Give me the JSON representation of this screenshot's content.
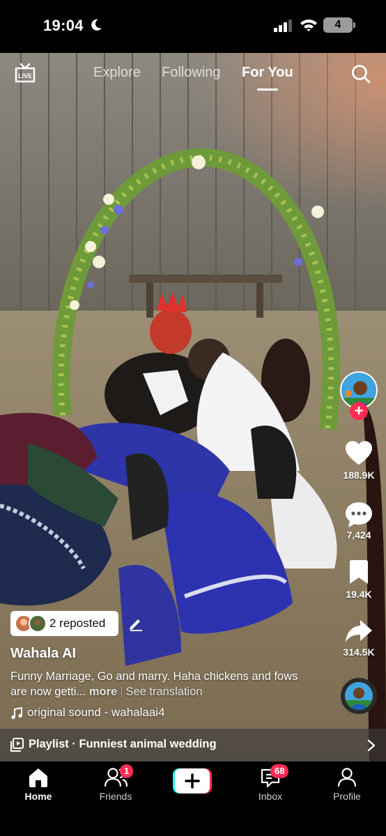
{
  "status_bar": {
    "time": "19:04",
    "battery": "4"
  },
  "top_nav": {
    "live_label": "LIVE",
    "tabs": [
      {
        "label": "Explore",
        "active": false
      },
      {
        "label": "Following",
        "active": false
      },
      {
        "label": "For You",
        "active": true
      }
    ]
  },
  "right_rail": {
    "likes": "188.9K",
    "comments": "7,424",
    "saves": "19.4K",
    "shares": "314.5K"
  },
  "post": {
    "repost_label": "2 reposted",
    "username": "Wahala AI",
    "caption": "Funny Marriage, Go and marry. Haha chickens and fows are now getti...",
    "more_label": "more",
    "translate_label": "See translation",
    "sound": "original sound - wahalaai4"
  },
  "playlist": {
    "label": "Playlist · Funniest animal wedding"
  },
  "tab_bar": {
    "items": [
      {
        "label": "Home",
        "active": true
      },
      {
        "label": "Friends",
        "badge": "1"
      },
      {
        "label": "Create"
      },
      {
        "label": "Inbox",
        "badge": "68"
      },
      {
        "label": "Profile"
      }
    ]
  },
  "colors": {
    "accent": "#fe2c55",
    "tiktok_cyan": "#25f4ee",
    "background": "#000000"
  }
}
